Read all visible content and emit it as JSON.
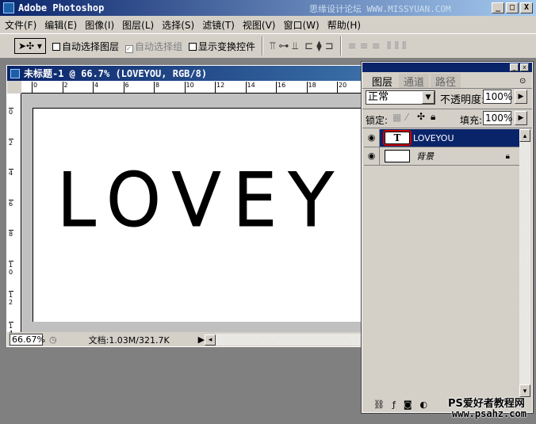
{
  "app": {
    "title": "Adobe Photoshop",
    "watermark_top": "思缘设计论坛 WWW.MISSYUAN.COM",
    "window_buttons": [
      "_",
      "□",
      "X"
    ]
  },
  "menu": [
    "文件(F)",
    "编辑(E)",
    "图像(I)",
    "图层(L)",
    "选择(S)",
    "滤镜(T)",
    "视图(V)",
    "窗口(W)",
    "帮助(H)"
  ],
  "options": {
    "auto_select_layer": "自动选择图层",
    "auto_select_group": "自动选择组",
    "show_transform": "显示变换控件",
    "auto_select_layer_checked": false,
    "auto_select_group_checked": true,
    "show_transform_checked": false
  },
  "document": {
    "title": "未标题-1 @ 66.7% (LOVEYOU, RGB/8)",
    "text": "LOVEY",
    "ruler_top": [
      "0",
      "2",
      "4",
      "6",
      "8",
      "10",
      "12",
      "14",
      "16",
      "18",
      "20"
    ],
    "ruler_left": [
      "0",
      "2",
      "4",
      "6",
      "8",
      "10",
      "12",
      "14"
    ],
    "zoom": "66.67%",
    "doc_info": "文档:1.03M/321.7K"
  },
  "layers_panel": {
    "tabs": [
      "图层",
      "通道",
      "路径"
    ],
    "active_tab": "图层",
    "blend_mode": "正常",
    "opacity_label": "不透明度:",
    "opacity": "100%",
    "lock_label": "锁定:",
    "fill_label": "填充:",
    "fill": "100%",
    "layers": [
      {
        "name": "LOVEYOU",
        "type": "text",
        "thumb": "T",
        "selected": true
      },
      {
        "name": "背景",
        "type": "background",
        "locked": true
      }
    ],
    "highlight_color": "#cc0000",
    "selected_color": "#0a246a"
  },
  "watermark_bottom": {
    "line1": "PS爱好者教程网",
    "line2": "www.psahz.com"
  }
}
